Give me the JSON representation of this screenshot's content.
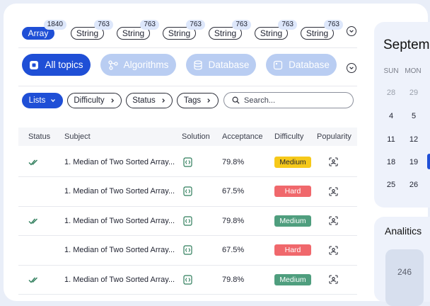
{
  "tags": [
    {
      "label": "Array",
      "count": "1840",
      "active": true
    },
    {
      "label": "String",
      "count": "763",
      "active": false
    },
    {
      "label": "String",
      "count": "763",
      "active": false
    },
    {
      "label": "String",
      "count": "763",
      "active": false
    },
    {
      "label": "String",
      "count": "763",
      "active": false
    },
    {
      "label": "String",
      "count": "763",
      "active": false
    },
    {
      "label": "String",
      "count": "763",
      "active": false
    }
  ],
  "topics": [
    {
      "label": "All topics",
      "icon": "grid-icon",
      "active": true
    },
    {
      "label": "Algorithms",
      "icon": "algorithm-icon",
      "active": false
    },
    {
      "label": "Database",
      "icon": "database-icon",
      "active": false
    },
    {
      "label": "Database",
      "icon": "database-window-icon",
      "active": false
    }
  ],
  "filters": [
    {
      "label": "Lists",
      "chevron": "chevron-down-icon",
      "active": true
    },
    {
      "label": "Difficulty",
      "chevron": "chevron-right-icon",
      "active": false
    },
    {
      "label": "Status",
      "chevron": "chevron-right-icon",
      "active": false
    },
    {
      "label": "Tags",
      "chevron": "chevron-right-icon",
      "active": false
    }
  ],
  "search": {
    "placeholder": "Search..."
  },
  "table": {
    "columns": [
      "Status",
      "Subject",
      "Solution",
      "Acceptance",
      "Difficulty",
      "Popularity"
    ],
    "rows": [
      {
        "solved": true,
        "subject": "1. Median of Two Sorted Array...",
        "acceptance": "79.8%",
        "difficulty": "Medium",
        "difficulty_style": "medium-y"
      },
      {
        "solved": false,
        "subject": "1. Median of Two Sorted Array...",
        "acceptance": "67.5%",
        "difficulty": "Hard",
        "difficulty_style": "hard"
      },
      {
        "solved": true,
        "subject": "1. Median of Two Sorted Array...",
        "acceptance": "79.8%",
        "difficulty": "Medium",
        "difficulty_style": "medium-g"
      },
      {
        "solved": false,
        "subject": "1. Median of Two Sorted Array...",
        "acceptance": "67.5%",
        "difficulty": "Hard",
        "difficulty_style": "hard"
      },
      {
        "solved": true,
        "subject": "1. Median of Two Sorted Array...",
        "acceptance": "79.8%",
        "difficulty": "Medium",
        "difficulty_style": "medium-g"
      }
    ]
  },
  "calendar": {
    "month": "Septem",
    "weekdays": [
      "SUN",
      "MON"
    ],
    "days": [
      [
        "28",
        "29"
      ],
      [
        "4",
        "5"
      ],
      [
        "11",
        "12"
      ],
      [
        "18",
        "19"
      ],
      [
        "25",
        "26"
      ]
    ]
  },
  "analytics": {
    "title": "Analitics",
    "value": "246"
  },
  "colors": {
    "accent": "#1f4fd6",
    "accent_light": "#b9cdf2",
    "medium": "#f6c91a",
    "hard": "#f0686c",
    "medium_green": "#4f9e7e",
    "check": "#2e7d5b"
  }
}
